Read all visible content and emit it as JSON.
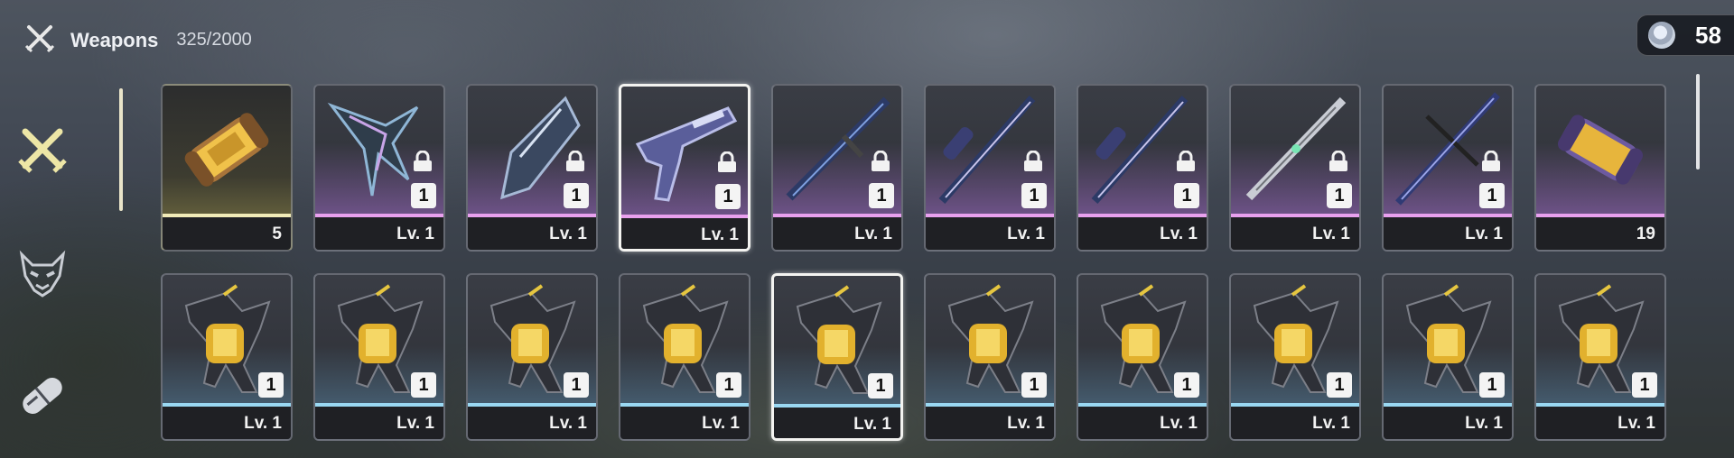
{
  "header": {
    "title": "Weapons",
    "count": "325/2000"
  },
  "currency": {
    "icon": "coin-icon",
    "amount": "58"
  },
  "sidebar": {
    "tabs": [
      {
        "name": "weapons",
        "icon": "crossed-swords-icon",
        "active": true
      },
      {
        "name": "echoes",
        "icon": "demon-mask-icon",
        "active": false
      },
      {
        "name": "items",
        "icon": "capsule-icon",
        "active": false
      }
    ]
  },
  "row1": [
    {
      "item": "gold-capsule",
      "rarity": "gold",
      "footer": "5",
      "locked": false,
      "badge": ""
    },
    {
      "item": "gauntlet",
      "rarity": "purple",
      "footer": "Lv. 1",
      "locked": true,
      "badge": "1"
    },
    {
      "item": "broadblade",
      "rarity": "purple",
      "footer": "Lv. 1",
      "locked": true,
      "badge": "1"
    },
    {
      "item": "pistol",
      "rarity": "purple",
      "footer": "Lv. 1",
      "locked": true,
      "badge": "1",
      "selected": true
    },
    {
      "item": "sword",
      "rarity": "purple",
      "footer": "Lv. 1",
      "locked": true,
      "badge": "1"
    },
    {
      "item": "rectifier",
      "rarity": "purple",
      "footer": "Lv. 1",
      "locked": true,
      "badge": "1"
    },
    {
      "item": "rectifier",
      "rarity": "purple",
      "footer": "Lv. 1",
      "locked": true,
      "badge": "1"
    },
    {
      "item": "blade",
      "rarity": "purple",
      "footer": "Lv. 1",
      "locked": true,
      "badge": "1"
    },
    {
      "item": "spear",
      "rarity": "purple",
      "footer": "Lv. 1",
      "locked": true,
      "badge": "1"
    },
    {
      "item": "purple-capsule",
      "rarity": "purple",
      "footer": "19",
      "locked": false,
      "badge": ""
    }
  ],
  "row2": [
    {
      "item": "gold-gauntlet",
      "rarity": "blue",
      "footer": "Lv. 1",
      "badge": "1"
    },
    {
      "item": "gold-gauntlet",
      "rarity": "blue",
      "footer": "Lv. 1",
      "badge": "1"
    },
    {
      "item": "gold-gauntlet",
      "rarity": "blue",
      "footer": "Lv. 1",
      "badge": "1"
    },
    {
      "item": "gold-gauntlet",
      "rarity": "blue",
      "footer": "Lv. 1",
      "badge": "1"
    },
    {
      "item": "gold-gauntlet",
      "rarity": "blue",
      "footer": "Lv. 1",
      "badge": "1",
      "selected": true
    },
    {
      "item": "gold-gauntlet",
      "rarity": "blue",
      "footer": "Lv. 1",
      "badge": "1"
    },
    {
      "item": "gold-gauntlet",
      "rarity": "blue",
      "footer": "Lv. 1",
      "badge": "1"
    },
    {
      "item": "gold-gauntlet",
      "rarity": "blue",
      "footer": "Lv. 1",
      "badge": "1"
    },
    {
      "item": "gold-gauntlet",
      "rarity": "blue",
      "footer": "Lv. 1",
      "badge": "1"
    },
    {
      "item": "gold-gauntlet",
      "rarity": "blue",
      "footer": "Lv. 1",
      "badge": "1"
    }
  ],
  "colors": {
    "purple": "#e8a0ee",
    "blue": "#9ad8f2",
    "gold": "#f1ebb8",
    "active_tab": "#ede6a6"
  }
}
